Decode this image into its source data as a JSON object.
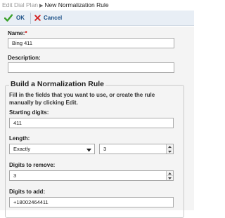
{
  "breadcrumb": {
    "parent": "Edit Dial Plan",
    "separator": "▶",
    "current": "New Normalization Rule"
  },
  "toolbar": {
    "ok_label": "OK",
    "cancel_label": "Cancel",
    "ok_icon": "checkmark-icon",
    "cancel_icon": "red-x-icon"
  },
  "form": {
    "name_label": "Name:",
    "name_required_mark": "*",
    "name_value": "Bing 411",
    "description_label": "Description:",
    "description_value": ""
  },
  "rule_builder": {
    "legend": "Build a Normalization Rule",
    "hint": "Fill in the fields that you want to use, or create the rule manually by clicking Edit.",
    "starting_digits_label": "Starting digits:",
    "starting_digits_value": "411",
    "length_label": "Length:",
    "length_mode_value": "Exactly",
    "length_value": "3",
    "digits_to_remove_label": "Digits to remove:",
    "digits_to_remove_value": "3",
    "digits_to_add_label": "Digits to add:",
    "digits_to_add_value": "+18002464411"
  },
  "colors": {
    "toolbar_bg": "#e8eef5",
    "toolbar_text": "#1a4f86",
    "ok_green": "#3aa12b",
    "cancel_red": "#d42a2a",
    "required": "#cc0000",
    "panel_bg": "#f4f4f4"
  }
}
